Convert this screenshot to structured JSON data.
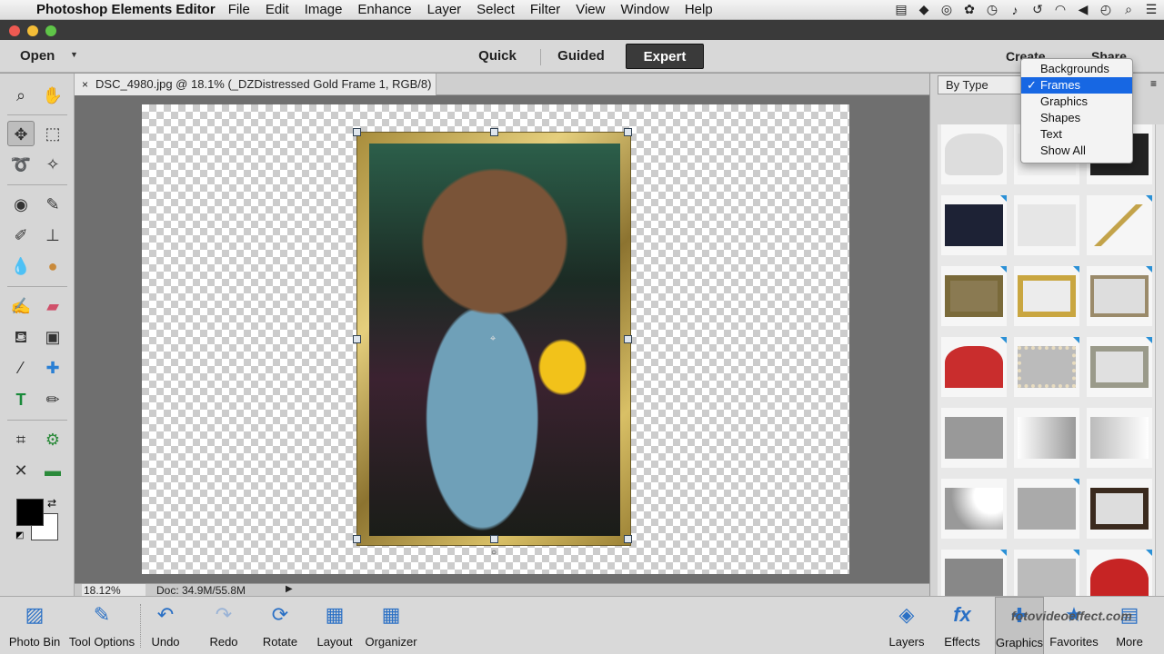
{
  "menubar": {
    "app_name": "Photoshop Elements Editor",
    "menus": [
      "File",
      "Edit",
      "Image",
      "Enhance",
      "Layer",
      "Select",
      "Filter",
      "View",
      "Window",
      "Help"
    ]
  },
  "modebar": {
    "open_label": "Open",
    "modes": [
      "Quick",
      "Guided",
      "Expert"
    ],
    "active_mode": "Expert",
    "create_label": "Create",
    "share_label": "Share"
  },
  "document": {
    "tab_title": "DSC_4980.jpg @ 18.1% (_DZDistressed Gold Frame 1, RGB/8) *",
    "close_glyph": "×"
  },
  "status": {
    "zoom": "18.12%",
    "doc_size": "Doc: 34.9M/55.8M"
  },
  "panel": {
    "filter_label": "By Type",
    "dropdown": {
      "items": [
        "Backgrounds",
        "Frames",
        "Graphics",
        "Shapes",
        "Text",
        "Show All"
      ],
      "selected": "Frames",
      "check_glyph": "✓"
    }
  },
  "bottombar": {
    "photo_bin": "Photo Bin",
    "tool_options": "Tool Options",
    "undo": "Undo",
    "redo": "Redo",
    "rotate": "Rotate",
    "layout": "Layout",
    "organizer": "Organizer",
    "layers": "Layers",
    "effects": "Effects",
    "graphics": "Graphics",
    "favorites": "Favorites",
    "more": "More"
  },
  "watermark": "fotovideoeffect.com",
  "colors": {
    "accent": "#1767e3",
    "active_mode_bg": "#3a3a3a",
    "thumb_badge": "#2a90d6",
    "foreground_swatch": "#000000",
    "background_swatch": "#ffffff"
  }
}
